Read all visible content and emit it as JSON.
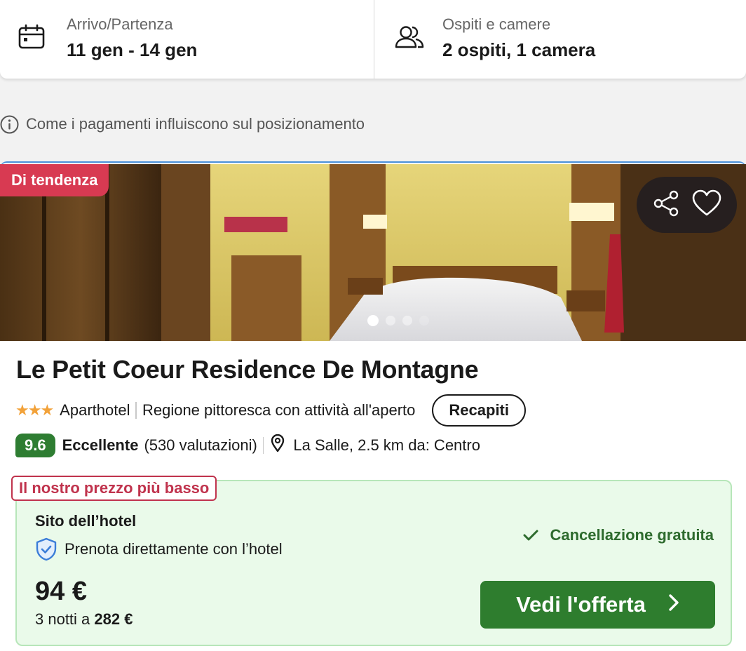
{
  "search": {
    "dates_label": "Arrivo/Partenza",
    "dates_value": "11 gen - 14 gen",
    "guests_label": "Ospiti e camere",
    "guests_value": "2 ospiti, 1 camera",
    "icons": [
      "calendar-icon",
      "users-icon"
    ]
  },
  "disclaimer": {
    "text": "Come i pagamenti influiscono sul posizionamento",
    "icon": "info-icon"
  },
  "hotel": {
    "badge": "Di tendenza",
    "name": "Le Petit Coeur Residence De Montagne",
    "stars": 3,
    "stars_text": "★★★",
    "type": "Aparthotel",
    "highlight": "Regione pittoresca con attività all'aperto",
    "contacts_label": "Recapiti",
    "score": "9.6",
    "rating_word": "Eccellente",
    "reviews": "(530 valutazioni)",
    "location": "La Salle, 2.5 km da: Centro",
    "photo": {
      "slide_count": 4,
      "active_slide": 1,
      "actions": [
        "share-icon",
        "heart-icon"
      ]
    }
  },
  "offer": {
    "badge": "Il nostro prezzo più basso",
    "provider": "Sito dell’hotel",
    "direct": "Prenota direttamente con l’hotel",
    "cancellation": "Cancellazione gratuita",
    "price": "94 €",
    "total_prefix": "3 notti a ",
    "total_amount": "282 €",
    "cta": "Vedi l'offerta"
  },
  "colors": {
    "trend_badge": "#d83a52",
    "score_bg": "#2e7d32",
    "cta_bg": "#2e7d2e",
    "offer_bg": "#eafaea",
    "lowest_badge": "#c0334d",
    "stars": "#f2a23a"
  }
}
